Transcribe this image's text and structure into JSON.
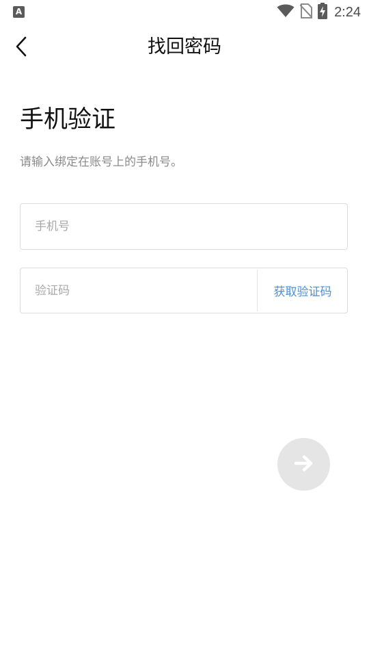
{
  "status_bar": {
    "app_icon": "A",
    "icons": [
      "wifi-icon",
      "no-sim-icon",
      "battery-charging-icon"
    ],
    "time": "2:24"
  },
  "nav": {
    "back_icon": "chevron-left-icon",
    "title": "找回密码"
  },
  "main": {
    "heading": "手机验证",
    "subtitle": "请输入绑定在账号上的手机号。",
    "phone_field": {
      "placeholder": "手机号",
      "value": ""
    },
    "code_field": {
      "placeholder": "验证码",
      "value": ""
    },
    "get_code_label": "获取验证码",
    "next_icon": "arrow-right-icon"
  },
  "colors": {
    "link": "#4a90d9",
    "next_button_bg": "#e5e5e5",
    "field_border": "#dcdcdc",
    "placeholder": "#a8a8a8",
    "subtitle": "#8a8a8a"
  }
}
